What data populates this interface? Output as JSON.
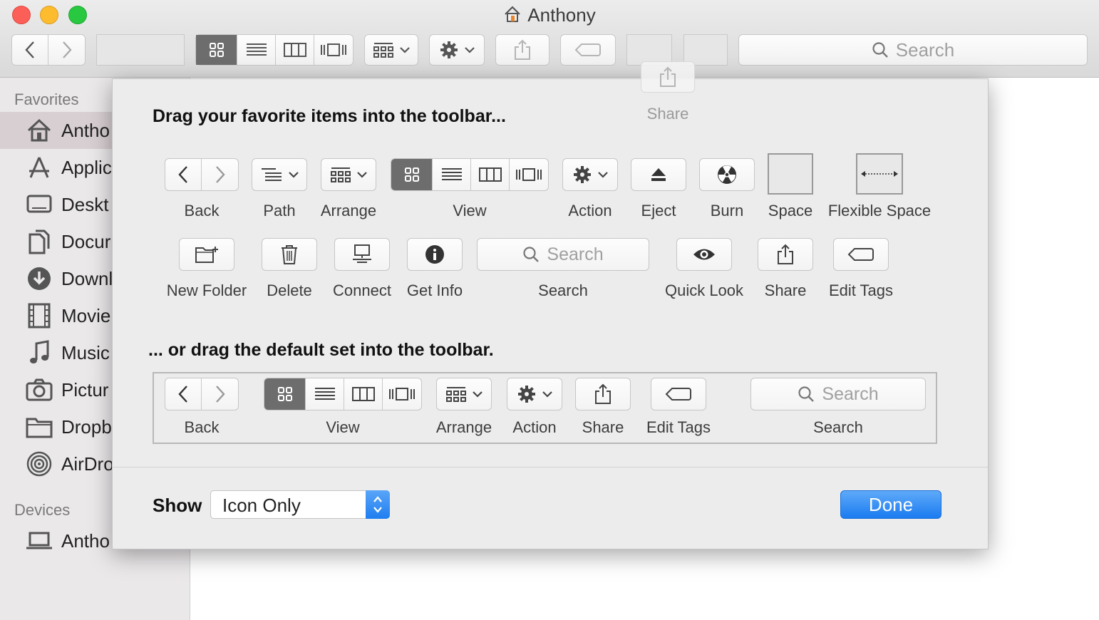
{
  "window": {
    "title": "Anthony"
  },
  "toolbar": {
    "search_label": "Search"
  },
  "floating_item": {
    "label": "Share"
  },
  "sidebar": {
    "favorites_header": "Favorites",
    "favorites": [
      {
        "label": "Antho",
        "icon": "home-icon"
      },
      {
        "label": "Applic",
        "icon": "applications-icon"
      },
      {
        "label": "Deskt",
        "icon": "desktop-icon"
      },
      {
        "label": "Docur",
        "icon": "documents-icon"
      },
      {
        "label": "Downl",
        "icon": "downloads-icon"
      },
      {
        "label": "Movie",
        "icon": "movies-icon"
      },
      {
        "label": "Music",
        "icon": "music-icon"
      },
      {
        "label": "Pictur",
        "icon": "camera-icon"
      },
      {
        "label": "Dropb",
        "icon": "folder-icon"
      },
      {
        "label": "AirDro",
        "icon": "airdrop-icon"
      }
    ],
    "devices_header": "Devices",
    "devices": [
      {
        "label": "Antho",
        "icon": "laptop-icon"
      }
    ]
  },
  "sheet": {
    "heading_favorites": "Drag your favorite items into the toolbar...",
    "heading_default": "... or drag the default set into the toolbar.",
    "items": {
      "back": "Back",
      "path": "Path",
      "arrange": "Arrange",
      "view": "View",
      "action": "Action",
      "eject": "Eject",
      "burn": "Burn",
      "space": "Space",
      "flexible_space": "Flexible Space",
      "new_folder": "New Folder",
      "delete": "Delete",
      "connect": "Connect",
      "get_info": "Get Info",
      "search": "Search",
      "search_placeholder": "Search",
      "quick_look": "Quick Look",
      "share": "Share",
      "edit_tags": "Edit Tags"
    },
    "default_set": {
      "back": "Back",
      "view": "View",
      "arrange": "Arrange",
      "action": "Action",
      "share": "Share",
      "edit_tags": "Edit Tags",
      "search": "Search",
      "search_placeholder": "Search"
    },
    "show_label": "Show",
    "show_value": "Icon Only",
    "done_label": "Done"
  },
  "colors": {
    "accent": "#1f7ef0",
    "close": "#fc5f57",
    "minimize": "#fdbc2e",
    "zoom": "#28c840"
  }
}
